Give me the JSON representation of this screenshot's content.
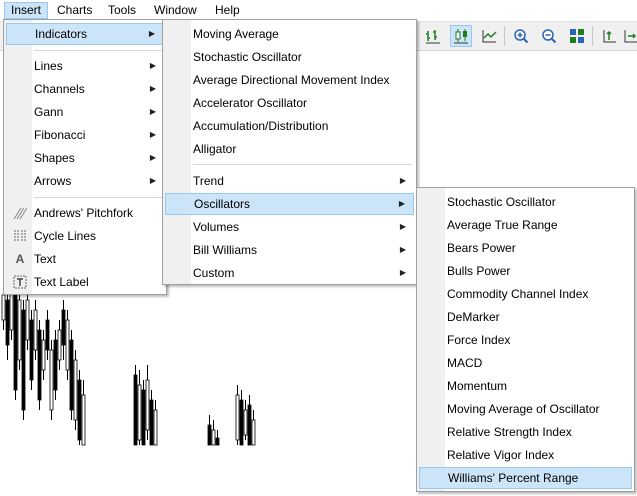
{
  "menubar": {
    "items": [
      {
        "label": "Insert",
        "active": true
      },
      {
        "label": "Charts",
        "active": false
      },
      {
        "label": "Tools",
        "active": false
      },
      {
        "label": "Window",
        "active": false
      },
      {
        "label": "Help",
        "active": false
      }
    ]
  },
  "toolbar": {
    "buttons": [
      "bar-chart-icon",
      "candlesticks-icon",
      "line-chart-icon",
      "zoom-in-icon",
      "zoom-out-icon",
      "tile-windows-icon",
      "chart-shift-icon",
      "auto-scroll-icon"
    ]
  },
  "insert_menu": {
    "items": [
      {
        "label": "Indicators",
        "submenu": true,
        "highlighted": true
      },
      {
        "label": "Lines",
        "submenu": true
      },
      {
        "label": "Channels",
        "submenu": true
      },
      {
        "label": "Gann",
        "submenu": true
      },
      {
        "label": "Fibonacci",
        "submenu": true
      },
      {
        "label": "Shapes",
        "submenu": true
      },
      {
        "label": "Arrows",
        "submenu": true
      },
      {
        "label": "Andrews' Pitchfork",
        "icon": "pitchfork-icon"
      },
      {
        "label": "Cycle Lines",
        "icon": "cycle-lines-icon"
      },
      {
        "label": "Text",
        "icon": "text-icon"
      },
      {
        "label": "Text Label",
        "icon": "text-label-icon"
      }
    ]
  },
  "indicators_menu": {
    "items": [
      {
        "label": "Moving Average"
      },
      {
        "label": "Stochastic Oscillator"
      },
      {
        "label": "Average Directional Movement Index"
      },
      {
        "label": "Accelerator Oscillator"
      },
      {
        "label": "Accumulation/Distribution"
      },
      {
        "label": "Alligator"
      },
      {
        "label": "Trend",
        "submenu": true
      },
      {
        "label": "Oscillators",
        "submenu": true,
        "highlighted": true
      },
      {
        "label": "Volumes",
        "submenu": true
      },
      {
        "label": "Bill Williams",
        "submenu": true
      },
      {
        "label": "Custom",
        "submenu": true
      }
    ]
  },
  "oscillators_menu": {
    "items": [
      {
        "label": "Stochastic Oscillator"
      },
      {
        "label": "Average True Range"
      },
      {
        "label": "Bears Power"
      },
      {
        "label": "Bulls Power"
      },
      {
        "label": "Commodity Channel Index"
      },
      {
        "label": "DeMarker"
      },
      {
        "label": "Force Index"
      },
      {
        "label": "MACD"
      },
      {
        "label": "Momentum"
      },
      {
        "label": "Moving Average of Oscillator"
      },
      {
        "label": "Relative Strength Index"
      },
      {
        "label": "Relative Vigor Index"
      },
      {
        "label": "Williams' Percent Range",
        "highlighted": true
      }
    ]
  },
  "colors": {
    "highlight": "#cce4f7",
    "highlight_border": "#99c9ef",
    "menu_bg": "#ffffff",
    "gutter_bg": "#f0f0f0"
  }
}
